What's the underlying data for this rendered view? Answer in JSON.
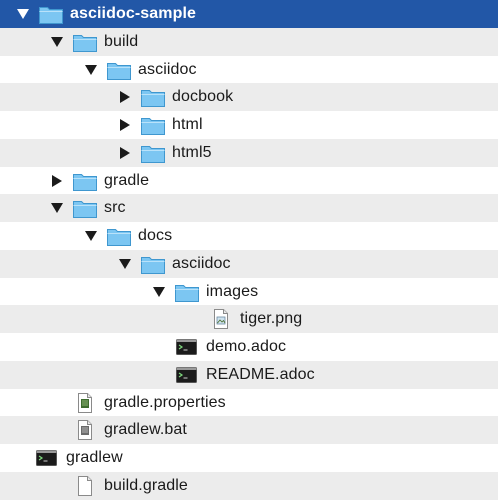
{
  "colors": {
    "selection": "#2257a7",
    "stripe": "#ececec",
    "folder": "#7cc6f2",
    "text": "#1a1a1a"
  },
  "tree": {
    "items": [
      {
        "label": "asciidoc-sample",
        "depth": 0,
        "kind": "folder",
        "state": "expanded",
        "selected": true,
        "icon": "folder-icon"
      },
      {
        "label": "build",
        "depth": 1,
        "kind": "folder",
        "state": "expanded",
        "icon": "folder-icon"
      },
      {
        "label": "asciidoc",
        "depth": 2,
        "kind": "folder",
        "state": "expanded",
        "icon": "folder-icon"
      },
      {
        "label": "docbook",
        "depth": 3,
        "kind": "folder",
        "state": "collapsed",
        "icon": "folder-icon"
      },
      {
        "label": "html",
        "depth": 3,
        "kind": "folder",
        "state": "collapsed",
        "icon": "folder-icon"
      },
      {
        "label": "html5",
        "depth": 3,
        "kind": "folder",
        "state": "collapsed",
        "icon": "folder-icon"
      },
      {
        "label": "gradle",
        "depth": 1,
        "kind": "folder",
        "state": "collapsed",
        "icon": "folder-icon"
      },
      {
        "label": "src",
        "depth": 1,
        "kind": "folder",
        "state": "expanded",
        "icon": "folder-icon"
      },
      {
        "label": "docs",
        "depth": 2,
        "kind": "folder",
        "state": "expanded",
        "icon": "folder-icon"
      },
      {
        "label": "asciidoc",
        "depth": 3,
        "kind": "folder",
        "state": "expanded",
        "icon": "folder-icon"
      },
      {
        "label": "images",
        "depth": 4,
        "kind": "folder",
        "state": "expanded",
        "icon": "folder-icon"
      },
      {
        "label": "tiger.png",
        "depth": 5,
        "kind": "image",
        "icon": "image-file-icon"
      },
      {
        "label": "demo.adoc",
        "depth": 4,
        "kind": "terminal",
        "icon": "terminal-file-icon"
      },
      {
        "label": "README.adoc",
        "depth": 4,
        "kind": "terminal",
        "icon": "terminal-file-icon"
      },
      {
        "label": "gradle.properties",
        "depth": 1,
        "kind": "properties",
        "icon": "properties-file-icon"
      },
      {
        "label": "gradlew.bat",
        "depth": 1,
        "kind": "batch",
        "icon": "batch-file-icon"
      },
      {
        "label": "gradlew",
        "depth": 0,
        "kind": "terminal",
        "icon": "terminal-file-icon",
        "iconOffset": -4
      },
      {
        "label": "build.gradle",
        "depth": 1,
        "kind": "document",
        "icon": "document-file-icon"
      }
    ]
  }
}
